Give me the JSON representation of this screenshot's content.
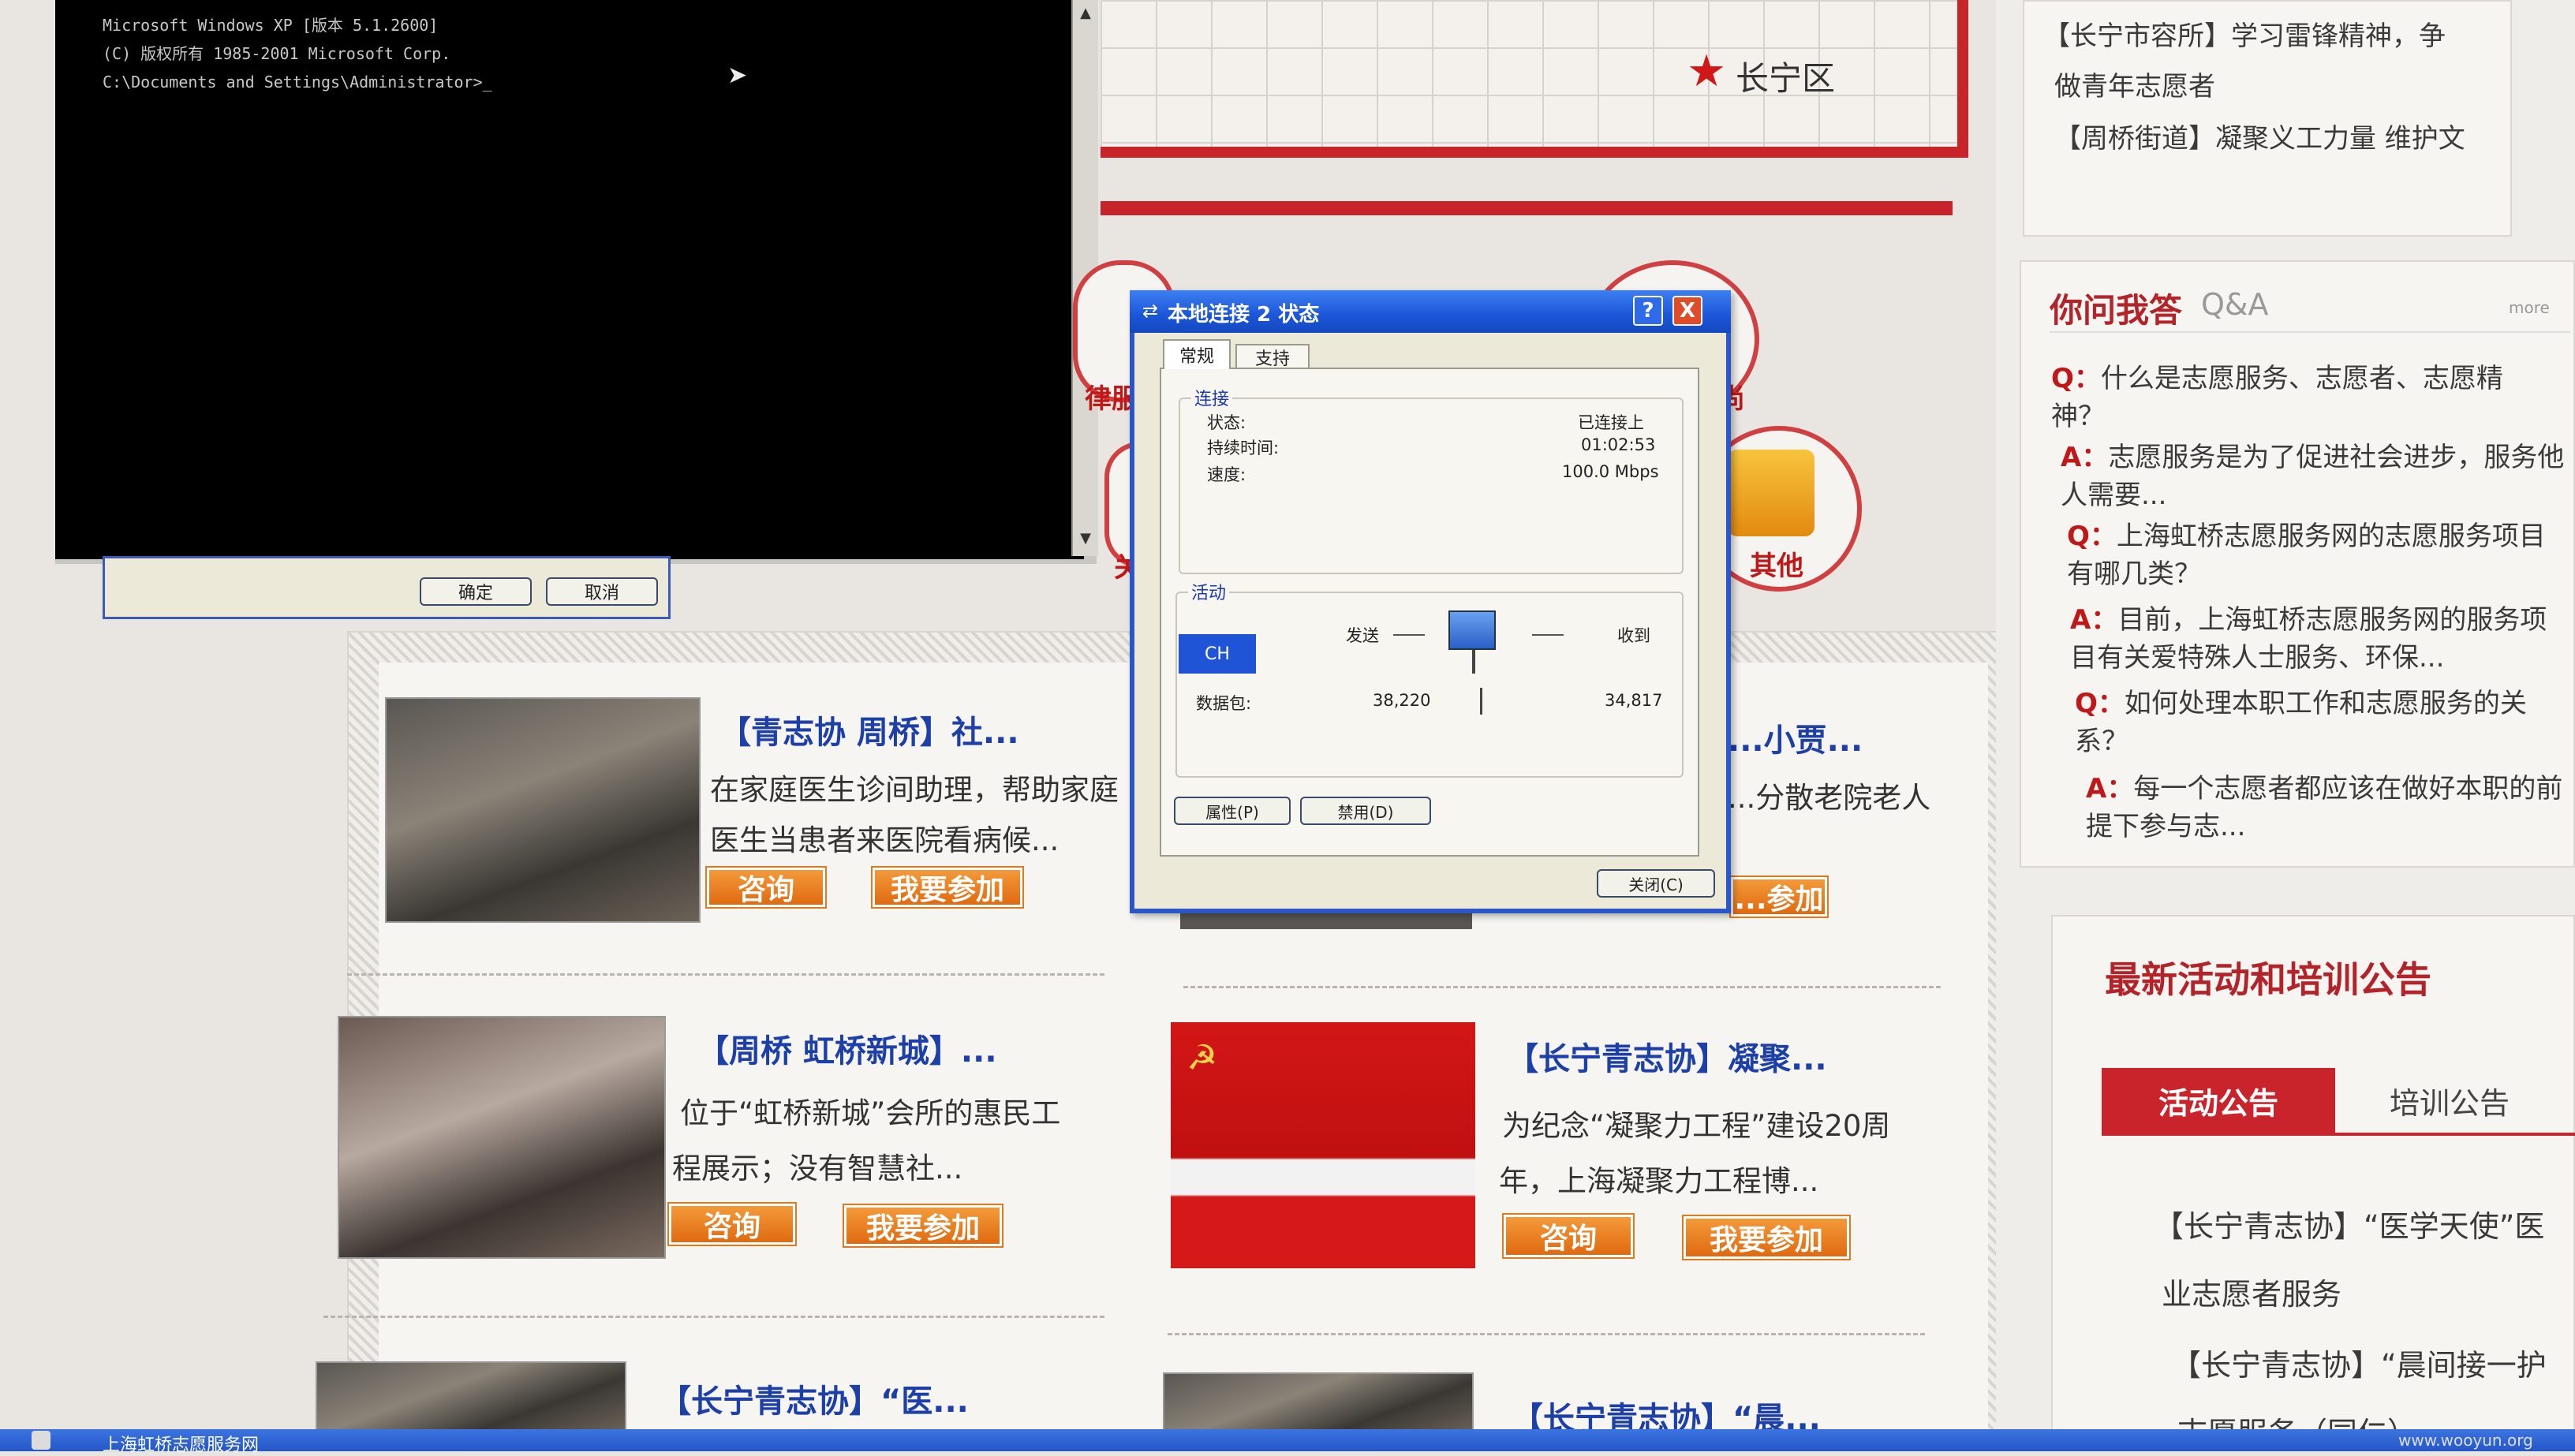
{
  "cmd": {
    "line1": "Microsoft Windows XP [版本 5.1.2600]",
    "line2": "(C) 版权所有 1985-2001 Microsoft Corp.",
    "line3": "C:\\Documents and Settings\\Administrator>_",
    "behind_ok": "确定",
    "behind_cancel": "取消"
  },
  "map": {
    "district": "长宁区"
  },
  "services": [
    {
      "label": "律服务"
    },
    {
      "label": "尚"
    },
    {
      "label": "关"
    },
    {
      "label": "其他"
    }
  ],
  "cards": [
    {
      "title": "【青志协 周桥】社...",
      "desc1": "在家庭医生诊间助理，帮助家庭",
      "desc2": "医生当患者来医院看病候...",
      "btn_consult": "咨询",
      "btn_join": "我要参加"
    },
    {
      "title": "...小贾...",
      "desc1": "...分散老院老人",
      "btn_join": "...参加"
    },
    {
      "title": "【周桥 虹桥新城】...",
      "desc1": "位于“虹桥新城”会所的惠民工",
      "desc2": "程展示；没有智慧社...",
      "btn_consult": "咨询",
      "btn_join": "我要参加"
    },
    {
      "title": "【长宁青志协】凝聚...",
      "desc1": "为纪念“凝聚力工程”建设20周",
      "desc2": "年，上海凝聚力工程博...",
      "btn_consult": "咨询",
      "btn_join": "我要参加"
    },
    {
      "title": "【长宁青志协】“医..."
    },
    {
      "title": "【长宁青志协】“晨..."
    }
  ],
  "sidebar": {
    "news1": "【长宁市容所】学习雷锋精神，争",
    "news2": "做青年志愿者",
    "news3": "【周桥街道】凝聚义工力量 维护文",
    "qa_title": "你问我答",
    "qa_sub": "Q&A",
    "qa_more": "more",
    "qa": [
      {
        "mark": "Q：",
        "text": "什么是志愿服务、志愿者、志愿精神？"
      },
      {
        "mark": "A：",
        "text": "志愿服务是为了促进社会进步，服务他人需要..."
      },
      {
        "mark": "Q：",
        "text": "上海虹桥志愿服务网的志愿服务项目有哪几类？"
      },
      {
        "mark": "A：",
        "text": "目前，上海虹桥志愿服务网的服务项目有关爱特殊人士服务、环保..."
      },
      {
        "mark": "Q：",
        "text": "如何处理本职工作和志愿服务的关系？"
      },
      {
        "mark": "A：",
        "text": "每一个志愿者都应该在做好本职的前提下参与志..."
      }
    ],
    "notice_title": "最新活动和培训公告",
    "tab_activity": "活动公告",
    "tab_training": "培训公告",
    "notice1": "【长宁青志协】“医学天使”医",
    "notice2": "业志愿者服务",
    "notice3": "【长宁青志协】“晨间接一护",
    "notice4": "志愿服务（同仁）"
  },
  "dialog": {
    "title": "本地连接 2 状态",
    "help": "?",
    "close_x": "X",
    "tab_general": "常规",
    "tab_support": "支持",
    "group_connection": "连接",
    "status_label": "状态:",
    "status_value": "已连接上",
    "duration_label": "持续时间:",
    "duration_value": "01:02:53",
    "speed_label": "速度:",
    "speed_value": "100.0 Mbps",
    "group_activity": "活动",
    "sent_label": "发送",
    "recv_label": "收到",
    "ime": "CH",
    "packets_label": "数据包:",
    "packets_sent": "38,220",
    "packets_recv": "34,817",
    "btn_properties": "属性(P)",
    "btn_disable": "禁用(D)",
    "btn_close": "关闭(C)"
  },
  "taskbar": {
    "item1": "上海虹桥志愿服务网",
    "watermark": "www.wooyun.org"
  }
}
